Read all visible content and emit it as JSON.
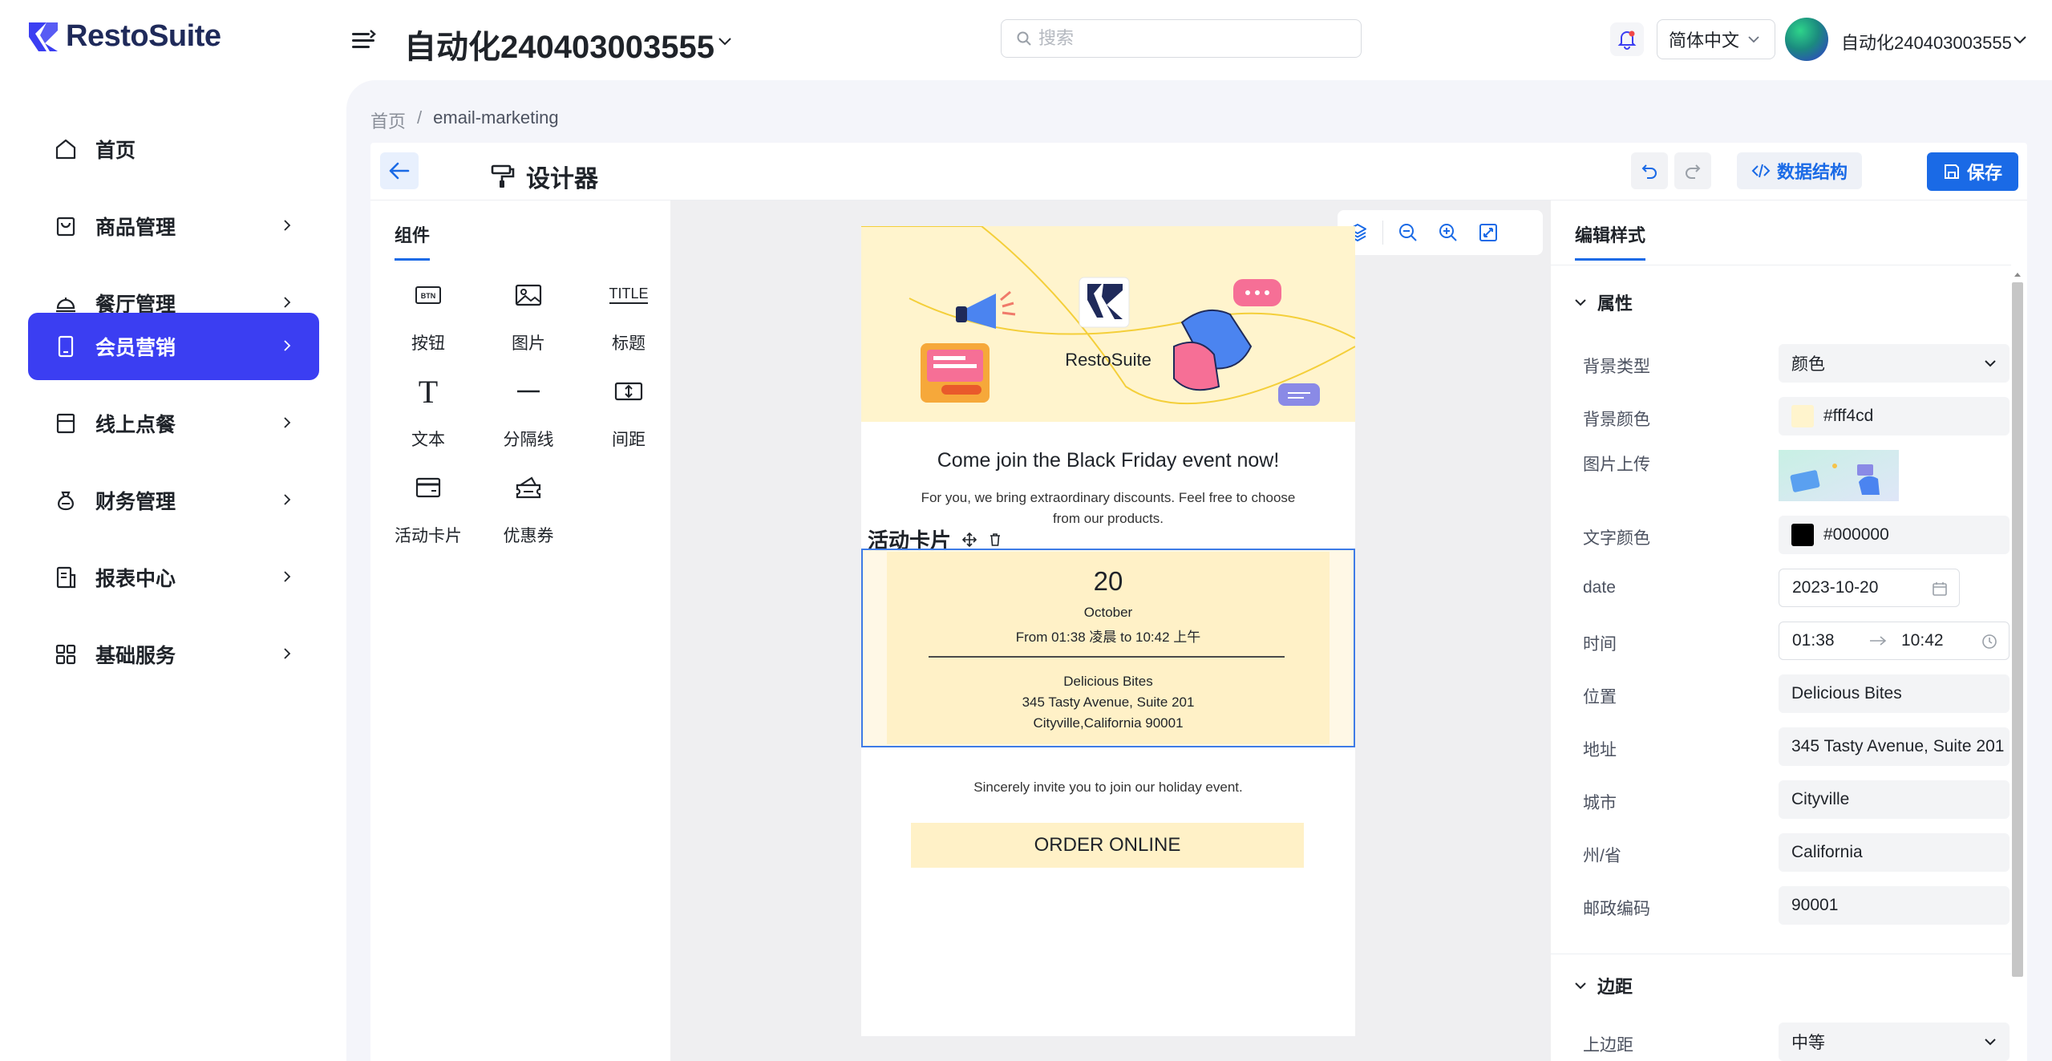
{
  "app": {
    "brand": "RestoSuite",
    "store_name": "自动化240403003555",
    "search_placeholder": "搜索",
    "language": "简体中文",
    "user_name": "自动化240403003555",
    "colors": {
      "primary": "#1a6ae6",
      "nav_active": "#3b3ef2",
      "hero_bg": "#fff4cd"
    }
  },
  "sidebar": {
    "items": [
      {
        "label": "首页",
        "icon": "home-icon",
        "active": false,
        "has_children": false
      },
      {
        "label": "商品管理",
        "icon": "shopping-bag-icon",
        "active": false,
        "has_children": true
      },
      {
        "label": "餐厅管理",
        "icon": "service-bell-icon",
        "active": false,
        "has_children": true
      },
      {
        "label": "会员营销",
        "icon": "mobile-phone-icon",
        "active": true,
        "has_children": true
      },
      {
        "label": "线上点餐",
        "icon": "storefront-icon",
        "active": false,
        "has_children": true
      },
      {
        "label": "财务管理",
        "icon": "money-bag-icon",
        "active": false,
        "has_children": true
      },
      {
        "label": "报表中心",
        "icon": "report-icon",
        "active": false,
        "has_children": true
      },
      {
        "label": "基础服务",
        "icon": "grid-apps-icon",
        "active": false,
        "has_children": true
      }
    ]
  },
  "breadcrumb": {
    "home": "首页",
    "separator": "/",
    "current": "email-marketing"
  },
  "designer": {
    "title": "设计器",
    "schema_button": "数据结构",
    "save_button": "保存"
  },
  "components": {
    "tab": "组件",
    "items": [
      {
        "label": "按钮",
        "icon": "button-icon",
        "glyph": "BTN"
      },
      {
        "label": "图片",
        "icon": "image-icon"
      },
      {
        "label": "标题",
        "icon": "title-icon",
        "glyph": "TITLE"
      },
      {
        "label": "文本",
        "icon": "text-icon",
        "glyph": "T"
      },
      {
        "label": "分隔线",
        "icon": "divider-icon"
      },
      {
        "label": "间距",
        "icon": "spacing-icon"
      },
      {
        "label": "活动卡片",
        "icon": "event-card-icon"
      },
      {
        "label": "优惠券",
        "icon": "coupon-icon"
      }
    ]
  },
  "email": {
    "hero_brand": "RestoSuite",
    "heading": "Come join the Black Friday event now!",
    "intro": "For you, we bring extraordinary discounts. Feel free to choose from our products.",
    "selected_block_label": "活动卡片",
    "event": {
      "day": "20",
      "month": "October",
      "time": "From 01:38 凌晨 to 10:42 上午",
      "venue": "Delicious Bites",
      "address": "345 Tasty Avenue, Suite 201",
      "city_line": "Cityville,California 90001"
    },
    "invite": "Sincerely invite you to join our holiday event.",
    "cta": "ORDER ONLINE"
  },
  "properties": {
    "tab": "编辑样式",
    "section_attributes": "属性",
    "section_padding": "边距",
    "fields": {
      "bg_type": {
        "label": "背景类型",
        "value": "颜色"
      },
      "bg_color": {
        "label": "背景颜色",
        "value": "#fff4cd",
        "swatch": "#fff4cd"
      },
      "image_upload": {
        "label": "图片上传"
      },
      "text_color": {
        "label": "文字颜色",
        "value": "#000000",
        "swatch": "#000000"
      },
      "date": {
        "label": "date",
        "value": "2023-10-20"
      },
      "time": {
        "label": "时间",
        "start": "01:38",
        "end": "10:42"
      },
      "location": {
        "label": "位置",
        "value": "Delicious Bites"
      },
      "address": {
        "label": "地址",
        "value": "345 Tasty Avenue, Suite 201"
      },
      "city": {
        "label": "城市",
        "value": "Cityville"
      },
      "state": {
        "label": "州/省",
        "value": "California"
      },
      "postcode": {
        "label": "邮政编码",
        "value": "90001"
      },
      "top_padding": {
        "label": "上边距",
        "value": "中等"
      }
    }
  }
}
